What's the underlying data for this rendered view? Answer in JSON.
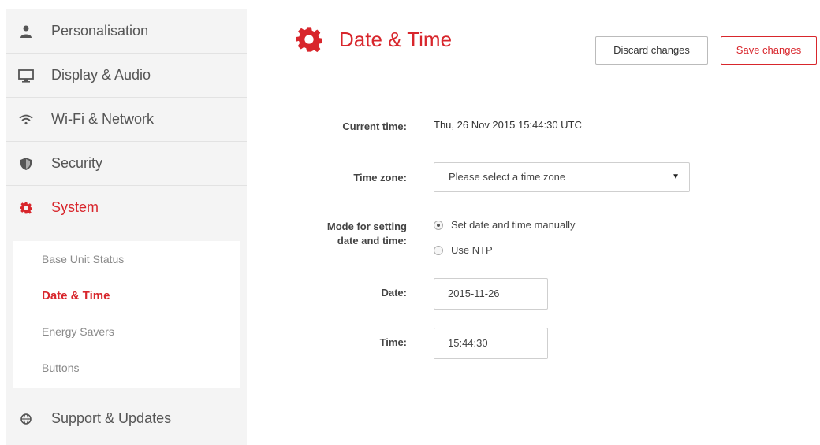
{
  "sidebar": {
    "items": [
      {
        "label": "Personalisation",
        "icon": "user-icon"
      },
      {
        "label": "Display & Audio",
        "icon": "monitor-icon"
      },
      {
        "label": "Wi-Fi & Network",
        "icon": "wifi-icon"
      },
      {
        "label": "Security",
        "icon": "shield-icon"
      },
      {
        "label": "System",
        "icon": "gear-icon",
        "active": true
      },
      {
        "label": "Support & Updates",
        "icon": "globe-icon"
      }
    ],
    "submenu": [
      {
        "label": "Base Unit Status"
      },
      {
        "label": "Date & Time",
        "active": true
      },
      {
        "label": "Energy Savers"
      },
      {
        "label": "Buttons"
      }
    ]
  },
  "header": {
    "title": "Date & Time",
    "discard_label": "Discard changes",
    "save_label": "Save changes"
  },
  "form": {
    "current_time_label": "Current time:",
    "current_time_value": "Thu, 26 Nov 2015 15:44:30 UTC",
    "timezone_label": "Time zone:",
    "timezone_value": "Please select a time zone",
    "mode_label_line1": "Mode for setting",
    "mode_label_line2": "date and time:",
    "mode_option_manual": "Set date and time manually",
    "mode_option_ntp": "Use NTP",
    "mode_selected": "manual",
    "date_label": "Date:",
    "date_value": "2015-11-26",
    "time_label": "Time:",
    "time_value": "15:44:30"
  },
  "colors": {
    "accent": "#d8262c",
    "sidebar_bg": "#f4f4f4"
  }
}
